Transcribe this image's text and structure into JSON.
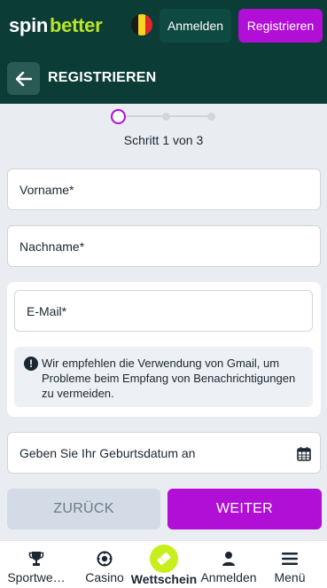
{
  "header": {
    "logo_primary": "spin",
    "logo_secondary": "better",
    "flag_colors": [
      "#1a1a1a",
      "#f6d324",
      "#e2262b"
    ],
    "login_label": "Anmelden",
    "register_label": "Registrieren"
  },
  "titlebar": {
    "title": "REGISTRIEREN"
  },
  "stepper": {
    "label": "Schritt 1 von 3",
    "current_step": 1,
    "total_steps": 3
  },
  "form": {
    "first_name_placeholder": "Vorname*",
    "last_name_placeholder": "Nachname*",
    "email_placeholder": "E-Mail*",
    "email_hint": "Wir empfehlen die Verwendung von Gmail, um Probleme beim Empfang von Benachrichtigungen zu vermeiden.",
    "birthdate_placeholder": "Geben Sie Ihr Geburtsdatum an"
  },
  "actions": {
    "back_label": "ZURÜCK",
    "next_label": "WEITER"
  },
  "bottom_nav": {
    "items": [
      {
        "label": "Sportwe…",
        "icon": "trophy-icon"
      },
      {
        "label": "Casino",
        "icon": "casino-chip-icon"
      },
      {
        "label": "Wettschein",
        "icon": "ticket-icon"
      },
      {
        "label": "Anmelden",
        "icon": "user-icon"
      },
      {
        "label": "Menü",
        "icon": "menu-icon"
      }
    ]
  },
  "colors": {
    "header_bg": "#0b3d36",
    "accent": "#b10ed6",
    "logo_accent": "#b9e52a",
    "bet_button": "#c7ef1e"
  }
}
